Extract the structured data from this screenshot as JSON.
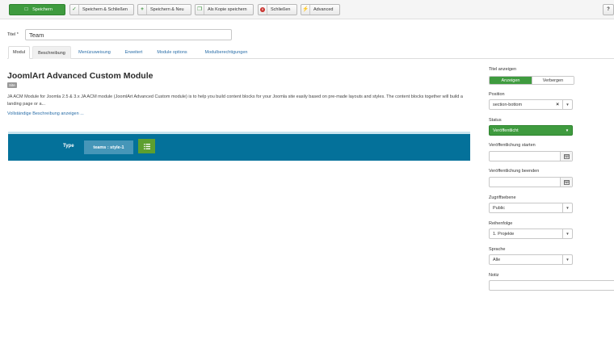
{
  "toolbar": {
    "save_label": "Speichern",
    "save_close_label": "Speichern & Schließen",
    "save_new_label": "Speichern & Neu",
    "save_copy_label": "Als Kopie speichern",
    "close_label": "Schließen",
    "advanced_label": "Advanced",
    "help_label": "?"
  },
  "title_field": {
    "label": "Titel *",
    "value": "Team"
  },
  "tabs": [
    {
      "label": "Modul"
    },
    {
      "label": "Beschreibung"
    },
    {
      "label": "Menüzuweisung"
    },
    {
      "label": "Erweitert"
    },
    {
      "label": "Module options"
    },
    {
      "label": "Modulberechtigungen"
    }
  ],
  "module": {
    "title": "JoomlArt Advanced Custom Module",
    "badge": "Site",
    "description": "JA ACM Module for Joomla 2.5 & 3.x JA ACM module (JoomlArt Advanced Custom module) is to help you build content blocks for your Joomla site easily based on pre-made layouts and styles. The content blocks together will build a landing page or a...",
    "more_link": "Vollständige Beschreibung anzeigen ..."
  },
  "acm": {
    "type_label": "Type",
    "type_value": "teams : style-1"
  },
  "sidebar": {
    "show_title_label": "Titel anzeigen",
    "show_option": "Anzeigen",
    "hide_option": "Verbergen",
    "position_label": "Position",
    "position_value": "section-bottom",
    "status_label": "Status",
    "status_value": "Veröffentlicht",
    "publish_start_label": "Veröffentlichung starten",
    "publish_end_label": "Veröffentlichung beenden",
    "access_label": "Zugriffsebene",
    "access_value": "Public",
    "ordering_label": "Reihenfolge",
    "ordering_value": "1. Projekte",
    "language_label": "Sprache",
    "language_value": "Alle",
    "note_label": "Notiz"
  },
  "colors": {
    "primary_green": "#3f9b3f",
    "acm_panel": "#04719a",
    "link_blue": "#2a6ea8"
  }
}
